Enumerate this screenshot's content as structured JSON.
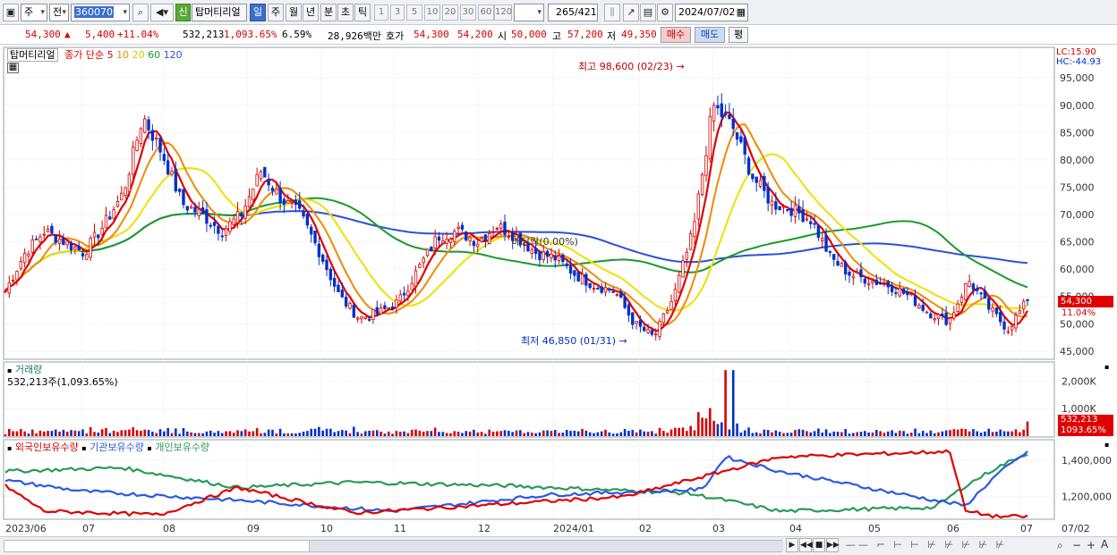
{
  "toolbar": {
    "period_sel": "주",
    "mode": "전",
    "code": "360070",
    "stock_name": "탑머티리얼",
    "credit_label": "신",
    "periods": [
      "일",
      "주",
      "월",
      "년",
      "분",
      "초",
      "틱"
    ],
    "active_period": "일",
    "numbers": [
      "1",
      "3",
      "5",
      "10",
      "20",
      "30",
      "60",
      "120"
    ],
    "count_display": "265",
    "count_total": "/421",
    "date": "2024/07/02"
  },
  "quote": {
    "price": "54,300",
    "change": "5,400",
    "change_pct": "+11.04%",
    "volume": "532,213",
    "volume_ratio": "1,093.65%",
    "turnover_rate": "6.59%",
    "amount": "28,926백만",
    "bid_label": "호가",
    "ask": "54,300",
    "bid": "54,200",
    "open_label": "시",
    "open": "50,000",
    "high_label": "고",
    "high": "57,200",
    "low_label": "저",
    "low": "49,350",
    "buy_label": "매수",
    "sell_label": "매도",
    "eval_label": "평"
  },
  "price_panel": {
    "stock_name": "탑머티리얼",
    "ma_label": "종가 단순",
    "ma_periods": [
      "5",
      "10",
      "20",
      "60",
      "120"
    ],
    "lc": "LC:15.90",
    "hc": "HC:-44.93",
    "high_note": "최고 98,600 (02/23)",
    "low_note": "최저 46,850 (01/31)",
    "dividend_note": "배당락(0.00%)",
    "last_price_tag": "54,300",
    "last_pct_tag": "11.04%",
    "y_ticks": [
      "95,000",
      "90,000",
      "85,000",
      "80,000",
      "75,000",
      "70,000",
      "65,000",
      "60,000",
      "55,000",
      "50,000",
      "45,000"
    ]
  },
  "volume_panel": {
    "title": "거래량",
    "value": "532,213주(1,093.65%)",
    "y_ticks": [
      "2,000K",
      "1,000K"
    ],
    "last_tag": "532,213",
    "last_pct": "1093.65%"
  },
  "holdings_panel": {
    "series": [
      "외국인보유수량",
      "기관보유수량",
      "개인보유수량"
    ],
    "y_ticks": [
      "1,400,000",
      "1,200,000"
    ]
  },
  "x_axis": [
    "2023/06",
    "07",
    "08",
    "09",
    "10",
    "11",
    "12",
    "2024/01",
    "02",
    "03",
    "04",
    "05",
    "06",
    "07"
  ],
  "x_axis_right": "07/02",
  "colors": {
    "up": "#d40000",
    "down": "#0030c8",
    "ma5": "#e00000",
    "ma10": "#f08a00",
    "ma20": "#f0e000",
    "ma60": "#1a9a2a",
    "ma120": "#2a50e0",
    "foreign": "#e00000",
    "institution": "#2a5ae0",
    "individual": "#2a9a5a"
  },
  "chart_data": {
    "type": "candlestick",
    "approximate_close_path": [
      [
        "2023/06",
        56000
      ],
      [
        "2023/06",
        63000
      ],
      [
        "2023/06",
        67000
      ],
      [
        "07",
        65000
      ],
      [
        "07",
        63000
      ],
      [
        "07",
        68000
      ],
      [
        "07",
        74000
      ],
      [
        "07",
        88000
      ],
      [
        "08",
        81000
      ],
      [
        "08",
        72000
      ],
      [
        "08",
        70000
      ],
      [
        "08",
        67000
      ],
      [
        "08",
        70000
      ],
      [
        "09",
        78000
      ],
      [
        "09",
        73000
      ],
      [
        "09",
        70000
      ],
      [
        "09",
        63000
      ],
      [
        "10",
        55000
      ],
      [
        "10",
        51000
      ],
      [
        "10",
        52000
      ],
      [
        "10",
        54000
      ],
      [
        "11",
        60000
      ],
      [
        "11",
        66000
      ],
      [
        "11",
        67000
      ],
      [
        "11",
        65000
      ],
      [
        "12",
        68000
      ],
      [
        "12",
        66000
      ],
      [
        "12",
        63000
      ],
      [
        "12",
        62000
      ],
      [
        "2024/01",
        59000
      ],
      [
        "2024/01",
        57000
      ],
      [
        "2024/01",
        56000
      ],
      [
        "2024/01",
        50000
      ],
      [
        "02",
        47500
      ],
      [
        "02",
        55000
      ],
      [
        "02",
        67000
      ],
      [
        "02",
        90000
      ],
      [
        "03",
        86000
      ],
      [
        "03",
        77000
      ],
      [
        "03",
        72000
      ],
      [
        "03",
        71000
      ],
      [
        "04",
        69000
      ],
      [
        "04",
        62000
      ],
      [
        "04",
        59000
      ],
      [
        "04",
        58000
      ],
      [
        "05",
        57000
      ],
      [
        "05",
        55000
      ],
      [
        "05",
        52000
      ],
      [
        "06",
        50500
      ],
      [
        "06",
        58000
      ],
      [
        "06",
        53000
      ],
      [
        "06",
        49000
      ],
      [
        "07",
        54300
      ]
    ]
  }
}
